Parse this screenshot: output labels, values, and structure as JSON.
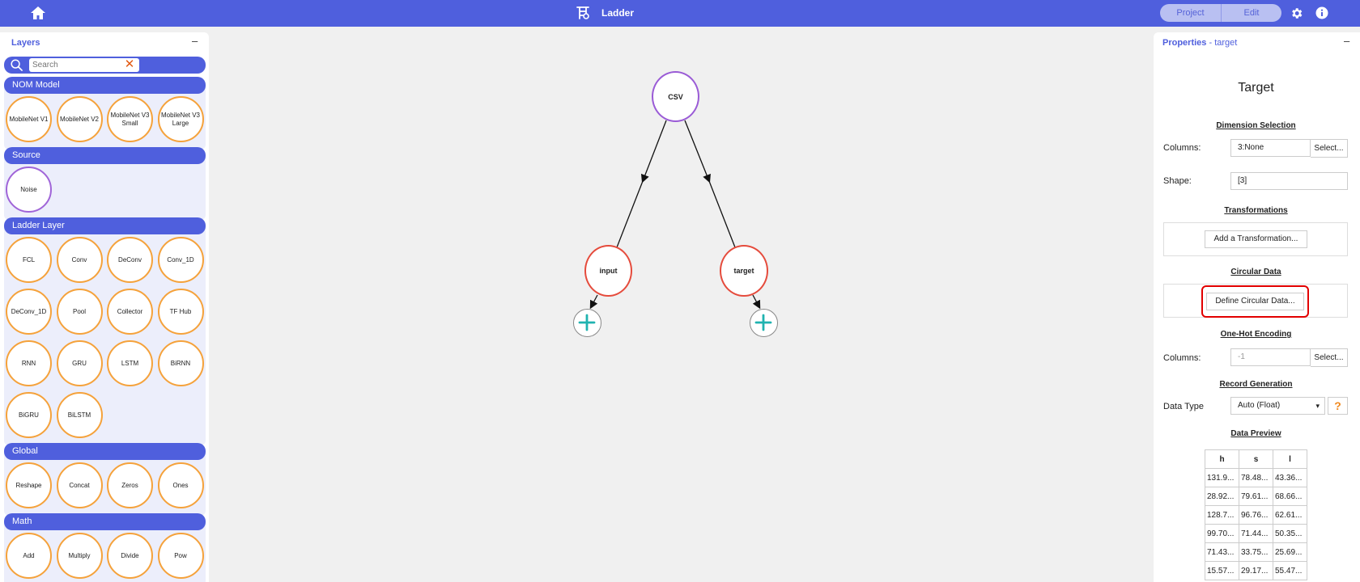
{
  "header": {
    "title": "Ladder",
    "tabs": [
      "Project",
      "Edit"
    ]
  },
  "layers": {
    "title": "Layers",
    "minimize": "–",
    "search": {
      "placeholder": "Search",
      "clear": "✕"
    },
    "categories": [
      {
        "name": "NOM Model",
        "items": [
          "MobileNet V1",
          "MobileNet V2",
          "MobileNet V3 Small",
          "MobileNet V3 Large"
        ]
      },
      {
        "name": "Source",
        "items": [
          "Noise"
        ]
      },
      {
        "name": "Ladder Layer",
        "items": [
          "FCL",
          "Conv",
          "DeConv",
          "Conv_1D",
          "DeConv_1D",
          "Pool",
          "Collector",
          "TF Hub",
          "RNN",
          "GRU",
          "LSTM",
          "BiRNN",
          "BiGRU",
          "BiLSTM"
        ]
      },
      {
        "name": "Global",
        "items": [
          "Reshape",
          "Concat",
          "Zeros",
          "Ones"
        ]
      },
      {
        "name": "Math",
        "items": [
          "Add",
          "Multiply",
          "Divide",
          "Pow"
        ]
      }
    ]
  },
  "graph": {
    "nodes": [
      "CSV",
      "input",
      "target"
    ]
  },
  "properties": {
    "title": "Properties",
    "subtitle": "- target",
    "minimize": "–",
    "heading": "Target",
    "dimension_selection": {
      "title": "Dimension Selection",
      "columns_label": "Columns:",
      "columns_value": "3:None",
      "select_label": "Select...",
      "shape_label": "Shape:",
      "shape_value": "[3]"
    },
    "transformations": {
      "title": "Transformations",
      "add_label": "Add a Transformation..."
    },
    "circular_data": {
      "title": "Circular Data",
      "define_label": "Define Circular Data..."
    },
    "one_hot": {
      "title": "One-Hot Encoding",
      "columns_label": "Columns:",
      "columns_placeholder": "-1",
      "select_label": "Select..."
    },
    "record_generation": {
      "title": "Record Generation",
      "data_type_label": "Data Type",
      "data_type_value": "Auto (Float)",
      "help": "?"
    },
    "data_preview": {
      "title": "Data Preview",
      "columns": [
        "h",
        "s",
        "l"
      ],
      "rows": [
        [
          "131.9...",
          "78.48...",
          "43.36..."
        ],
        [
          "28.92...",
          "79.61...",
          "68.66..."
        ],
        [
          "128.7...",
          "96.76...",
          "62.61..."
        ],
        [
          "99.70...",
          "71.44...",
          "50.35..."
        ],
        [
          "71.43...",
          "33.75...",
          "25.69..."
        ],
        [
          "15.57...",
          "29.17...",
          "55.47..."
        ]
      ]
    }
  }
}
